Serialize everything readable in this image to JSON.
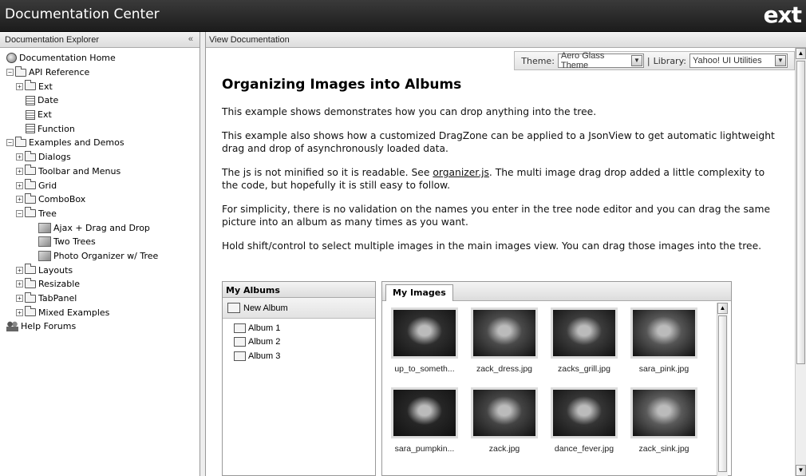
{
  "app": {
    "title": "Documentation Center",
    "logo": "ext"
  },
  "explorer": {
    "title": "Documentation Explorer",
    "collapse_glyph": "«",
    "tree": [
      {
        "label": "Documentation Home",
        "icon": "globe-icon",
        "level": 0,
        "toggle": ""
      },
      {
        "label": "API Reference",
        "icon": "folder-open-icon",
        "level": 0,
        "toggle": "−"
      },
      {
        "label": "Ext",
        "icon": "folder-icon",
        "level": 1,
        "toggle": "+"
      },
      {
        "label": "Date",
        "icon": "class-doc-icon",
        "level": 2,
        "toggle": ""
      },
      {
        "label": "Ext",
        "icon": "class-doc-icon",
        "level": 2,
        "toggle": ""
      },
      {
        "label": "Function",
        "icon": "class-doc-icon",
        "level": 2,
        "toggle": ""
      },
      {
        "label": "Examples and Demos",
        "icon": "folder-open-icon",
        "level": 0,
        "toggle": "−"
      },
      {
        "label": "Dialogs",
        "icon": "folder-icon",
        "level": 1,
        "toggle": "+"
      },
      {
        "label": "Toolbar and Menus",
        "icon": "folder-icon",
        "level": 1,
        "toggle": "+"
      },
      {
        "label": "Grid",
        "icon": "folder-icon",
        "level": 1,
        "toggle": "+"
      },
      {
        "label": "ComboBox",
        "icon": "folder-icon",
        "level": 1,
        "toggle": "+"
      },
      {
        "label": "Tree",
        "icon": "folder-open-icon",
        "level": 1,
        "toggle": "−"
      },
      {
        "label": "Ajax + Drag and Drop",
        "icon": "example-icon",
        "level": 3,
        "toggle": ""
      },
      {
        "label": "Two Trees",
        "icon": "example-icon",
        "level": 3,
        "toggle": ""
      },
      {
        "label": "Photo Organizer w/ Tree",
        "icon": "example-icon",
        "level": 3,
        "toggle": ""
      },
      {
        "label": "Layouts",
        "icon": "folder-icon",
        "level": 1,
        "toggle": "+"
      },
      {
        "label": "Resizable",
        "icon": "folder-icon",
        "level": 1,
        "toggle": "+"
      },
      {
        "label": "TabPanel",
        "icon": "folder-icon",
        "level": 1,
        "toggle": "+"
      },
      {
        "label": "Mixed Examples",
        "icon": "folder-icon",
        "level": 1,
        "toggle": "+"
      },
      {
        "label": "Help Forums",
        "icon": "people-icon",
        "level": 0,
        "toggle": ""
      }
    ]
  },
  "view": {
    "title": "View Documentation",
    "toolbar": {
      "theme_label": "Theme:",
      "theme_value": "Aero Glass Theme",
      "separator": "|",
      "library_label": "Library:",
      "library_value": "Yahoo! UI Utilities"
    },
    "heading": "Organizing Images into Albums",
    "p1": "This example shows demonstrates how you can drop anything into the tree.",
    "p2": "This example also shows how a customized DragZone can be applied to a JsonView to get automatic lightweight drag and drop of asynchronously loaded data.",
    "p3_before": "The js is not minified so it is readable. See ",
    "p3_link": "organizer.js",
    "p3_after": ". The multi image drag drop added a little complexity to the code, but hopefully it is still easy to follow.",
    "p4": "For simplicity, there is no validation on the names you enter in the tree node editor and you can drag the same picture into an album as many times as you want.",
    "p5": "Hold shift/control to select multiple images in the main images view. You can drag those images into the tree."
  },
  "albums": {
    "title": "My Albums",
    "new_label": "New Album",
    "items": [
      "Album 1",
      "Album 2",
      "Album 3"
    ]
  },
  "images": {
    "tab": "My Images",
    "items": [
      {
        "caption": "up_to_someth...",
        "tone": "#2e2e2e"
      },
      {
        "caption": "zack_dress.jpg",
        "tone": "#4a4a4a"
      },
      {
        "caption": "zacks_grill.jpg",
        "tone": "#3c3c3c"
      },
      {
        "caption": "sara_pink.jpg",
        "tone": "#555555"
      },
      {
        "caption": "sara_pumpkin...",
        "tone": "#262626"
      },
      {
        "caption": "zack.jpg",
        "tone": "#444444"
      },
      {
        "caption": "dance_fever.jpg",
        "tone": "#353535"
      },
      {
        "caption": "zack_sink.jpg",
        "tone": "#5a5a5a"
      }
    ]
  }
}
